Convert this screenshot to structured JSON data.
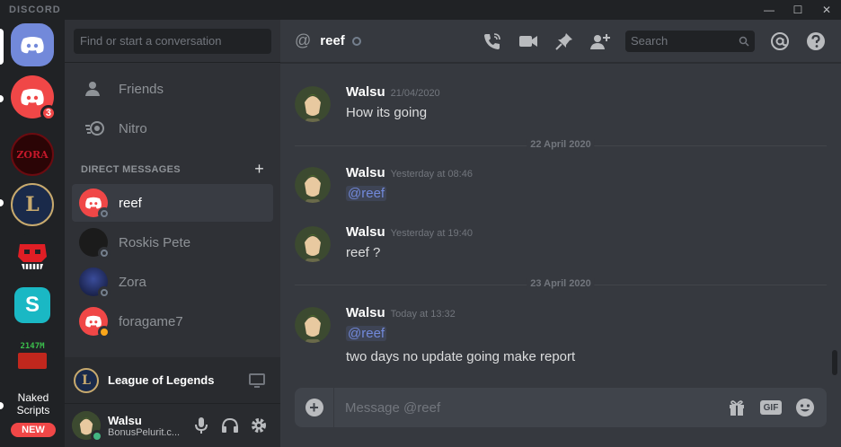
{
  "titlebar": {
    "brand": "DISCORD",
    "minimize": "—",
    "maximize": "☐",
    "close": "✕"
  },
  "guilds": {
    "items": [
      {
        "name": "home",
        "icon": "discord-logo-icon",
        "color": "#7289da"
      },
      {
        "name": "discord-server",
        "icon": "discord-logo-icon",
        "color": "#f04747",
        "badge": "3"
      },
      {
        "name": "zora-server",
        "text": "ZORA"
      },
      {
        "name": "league-of-legends-server",
        "text": "L"
      },
      {
        "name": "red-skull-server"
      },
      {
        "name": "s-server",
        "text": "S"
      },
      {
        "name": "2147m-server",
        "text": "2147M"
      }
    ],
    "naked_scripts": "Naked Scripts",
    "new_badge": "NEW"
  },
  "sidebar": {
    "search_placeholder": "Find or start a conversation",
    "nav": [
      {
        "label": "Friends",
        "icon": "friends-icon"
      },
      {
        "label": "Nitro",
        "icon": "nitro-icon"
      }
    ],
    "dm_header": "DIRECT MESSAGES",
    "dm_add": "+",
    "dms": [
      {
        "name": "reef",
        "status": "offline",
        "selected": true
      },
      {
        "name": "Roskis Pete",
        "status": "offline"
      },
      {
        "name": "Zora",
        "status": "offline"
      },
      {
        "name": "foragame7",
        "status": "idle"
      }
    ],
    "game": {
      "title": "League of Legends"
    },
    "user": {
      "name": "Walsu",
      "tag": "BonusPelurit.c..."
    }
  },
  "chat": {
    "header": {
      "name": "reef",
      "search_placeholder": "Search",
      "at_symbol": "@"
    },
    "messages": [
      {
        "author": "Walsu",
        "timestamp": "21/04/2020",
        "lines": [
          {
            "text": "How its going"
          }
        ]
      },
      {
        "author": "Walsu",
        "timestamp": "Yesterday at 08:46",
        "lines": [
          {
            "mention": "@reef"
          }
        ]
      },
      {
        "author": "Walsu",
        "timestamp": "Yesterday at 19:40",
        "lines": [
          {
            "text": "reef ?"
          }
        ]
      },
      {
        "author": "Walsu",
        "timestamp": "Today at 13:32",
        "lines": [
          {
            "mention": "@reef"
          },
          {
            "text": "two days no update going make report"
          }
        ]
      }
    ],
    "dividers": [
      "22 April 2020",
      "23 April 2020"
    ],
    "composer": {
      "placeholder": "Message @reef",
      "gif": "GIF"
    }
  }
}
